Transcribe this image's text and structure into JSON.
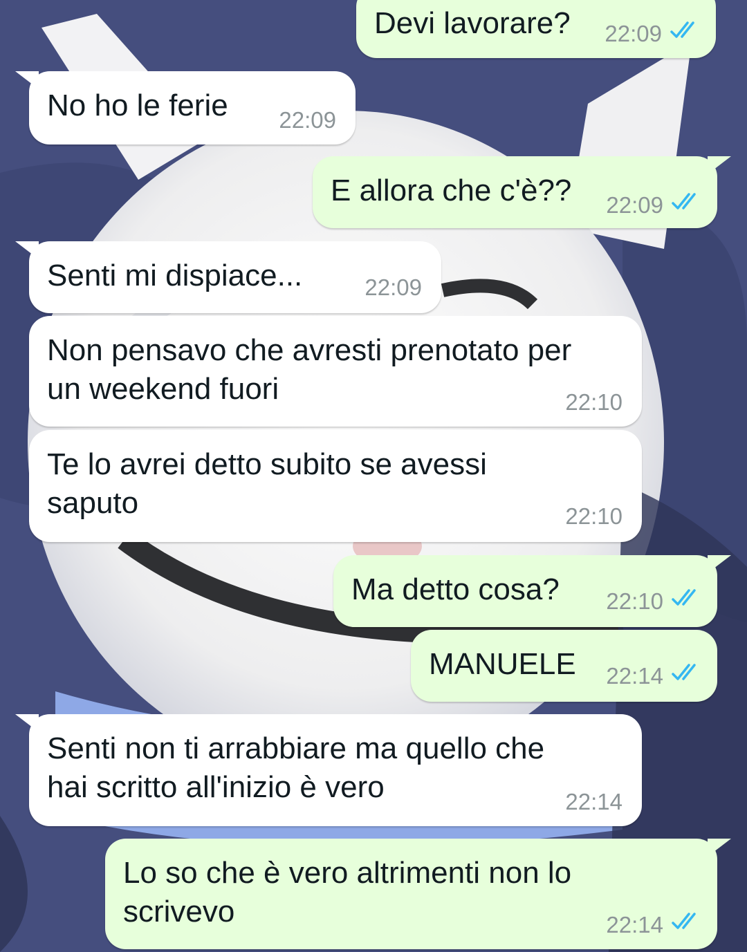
{
  "colors": {
    "incoming_bubble": "#ffffff",
    "outgoing_bubble": "#e7ffdb",
    "read_ticks": "#34b7f1",
    "timestamp": "#8c9497",
    "wallpaper": "#414a7a"
  },
  "icons": {
    "read_receipt": "double-check-icon"
  },
  "messages": [
    {
      "direction": "out",
      "text": "Devi lavorare?",
      "time": "22:09",
      "status": "read"
    },
    {
      "direction": "in",
      "text": "No ho le ferie",
      "time": "22:09"
    },
    {
      "direction": "out",
      "text": "E allora che c'è??",
      "time": "22:09",
      "status": "read"
    },
    {
      "direction": "in",
      "text": "Senti mi dispiace...",
      "time": "22:09"
    },
    {
      "direction": "in",
      "text": "Non pensavo che avresti prenotato per\nun weekend fuori",
      "time": "22:10"
    },
    {
      "direction": "in",
      "text": "Te lo avrei detto subito se avessi\nsaputo",
      "time": "22:10"
    },
    {
      "direction": "out",
      "text": "Ma detto cosa?",
      "time": "22:10",
      "status": "read"
    },
    {
      "direction": "out",
      "text": "MANUELE",
      "time": "22:14",
      "status": "read"
    },
    {
      "direction": "in",
      "text": "Senti non ti arrabbiare ma quello che\nhai scritto all'inizio è vero",
      "time": "22:14"
    },
    {
      "direction": "out",
      "text": "Lo so che è vero altrimenti non lo\nscrivevo",
      "time": "22:14",
      "status": "read"
    }
  ]
}
